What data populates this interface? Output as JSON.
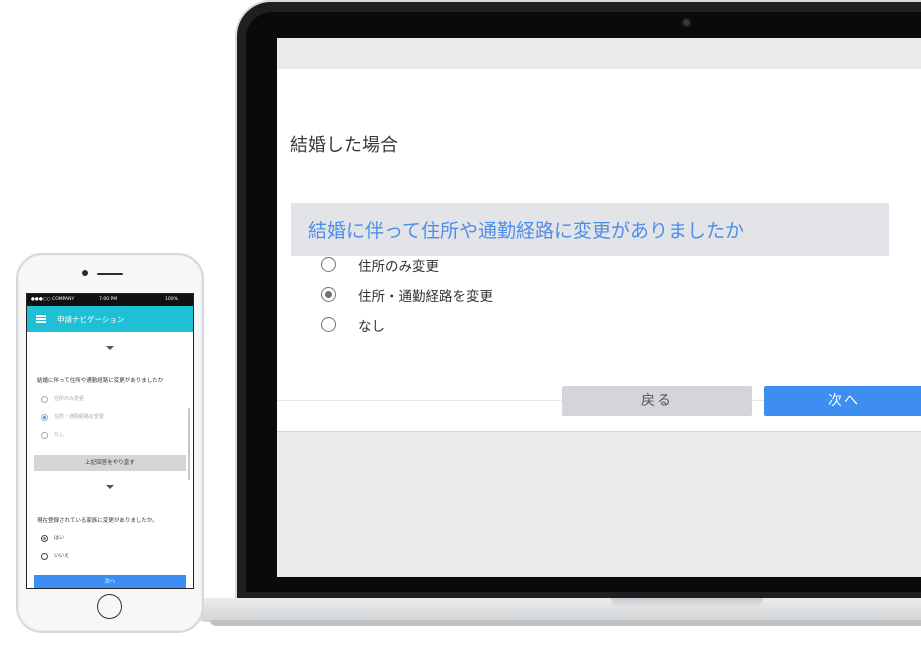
{
  "laptop": {
    "page_title": "結婚した場合",
    "question": "結婚に伴って住所や通勤経路に変更がありましたか",
    "options": [
      {
        "label": "住所のみ変更",
        "selected": false
      },
      {
        "label": "住所・通勤経路を変更",
        "selected": true
      },
      {
        "label": "なし",
        "selected": false
      }
    ],
    "back_label": "戻る",
    "next_label": "次へ"
  },
  "phone": {
    "status": {
      "carrier": "●●●○○ COMPANY",
      "time": "7:00 PM",
      "battery": "100%"
    },
    "app_title": "申請ナビゲーション",
    "question1": "結婚に伴って住所や通勤経路に変更がありましたか",
    "options1": [
      {
        "label": "住所のみ変更",
        "selected": false
      },
      {
        "label": "住所・通勤経路を変更",
        "selected": true
      },
      {
        "label": "なし",
        "selected": false
      }
    ],
    "redo_label": "上記回答をやり直す",
    "question2": "現在登録されている家族に変更がありましたか。",
    "options2": [
      {
        "label": "はい",
        "selected": true
      },
      {
        "label": "いいえ",
        "selected": false
      }
    ],
    "next_label": "次へ"
  },
  "colors": {
    "accent": "#3d8ef0",
    "question_text": "#4e8eea",
    "app_bar": "#1fbfd6"
  }
}
